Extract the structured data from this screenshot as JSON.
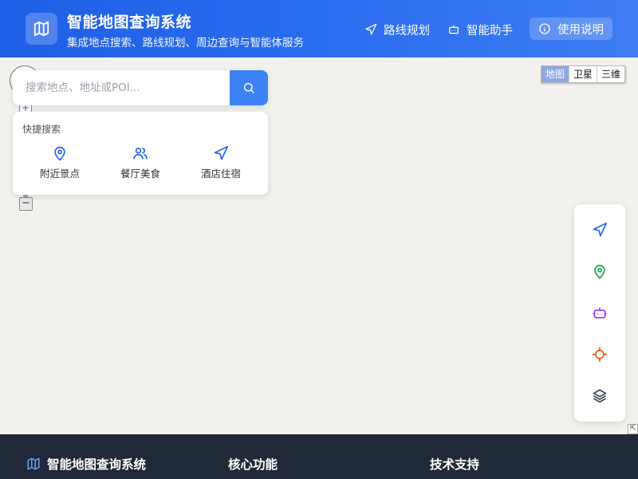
{
  "header": {
    "title": "智能地图查询系统",
    "subtitle": "集成地点搜索、路线规划、周边查询与智能体服务",
    "nav": {
      "route": "路线规划",
      "assistant": "智能助手",
      "help": "使用说明"
    }
  },
  "map_type": {
    "options": [
      "地图",
      "卫星",
      "三维"
    ],
    "selected": "地图"
  },
  "map_controls": {
    "zoom_in": "+",
    "zoom_out": "−",
    "corner_toggle": "⇱"
  },
  "search": {
    "placeholder": "搜索地点、地址或POI..."
  },
  "quick_search": {
    "title": "快捷搜索",
    "items": [
      {
        "label": "附近景点",
        "icon": "map-pin-icon"
      },
      {
        "label": "餐厅美食",
        "icon": "users-icon"
      },
      {
        "label": "酒店住宿",
        "icon": "navigation-icon"
      }
    ]
  },
  "toolbar": {
    "tools": [
      {
        "icon": "navigation-icon",
        "color": "#2563eb"
      },
      {
        "icon": "map-pin-icon",
        "color": "#16a34a"
      },
      {
        "icon": "bot-icon",
        "color": "#9333ea"
      },
      {
        "icon": "locate-icon",
        "color": "#ea580c"
      },
      {
        "icon": "layers-icon",
        "color": "#374151"
      }
    ]
  },
  "footer": {
    "brand": "智能地图查询系统",
    "col1_title": "核心功能",
    "col2_title": "技术支持"
  },
  "colors": {
    "header_start": "#1f5fe6",
    "header_end": "#3e7df2",
    "accent": "#3c82f6",
    "footer_bg": "#1f2937",
    "map_bg": "#f2f1ee"
  }
}
